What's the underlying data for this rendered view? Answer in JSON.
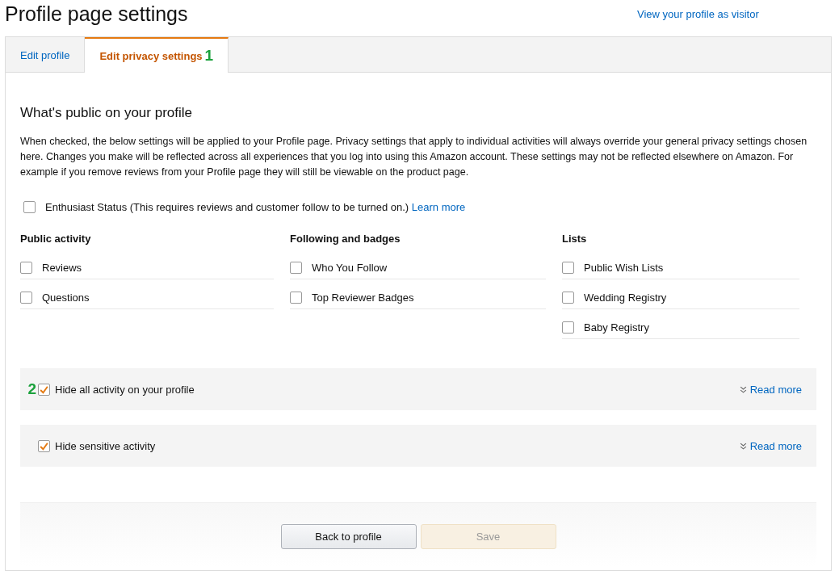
{
  "page": {
    "title": "Profile page settings",
    "visitor_link": "View your profile as visitor"
  },
  "tabs": [
    {
      "label": "Edit profile",
      "selected": false
    },
    {
      "label": "Edit privacy settings",
      "selected": true,
      "callout": "1"
    }
  ],
  "section": {
    "heading": "What's public on your profile",
    "description": "When checked, the below settings will be applied to your Profile page. Privacy settings that apply to individual activities will always override your general privacy settings chosen here. Changes you make will be reflected across all experiences that you log into using this Amazon account. These settings may not be reflected elsewhere on Amazon. For example if you remove reviews from your Profile page they will still be viewable on the product page."
  },
  "enthusiast": {
    "label": "Enthusiast Status (This requires reviews and customer follow to be turned on.)",
    "link": "Learn more",
    "checked": false
  },
  "groups": [
    {
      "heading": "Public activity",
      "items": [
        {
          "label": "Reviews",
          "checked": false
        },
        {
          "label": "Questions",
          "checked": false
        }
      ]
    },
    {
      "heading": "Following and badges",
      "items": [
        {
          "label": "Who You Follow",
          "checked": false
        },
        {
          "label": "Top Reviewer Badges",
          "checked": false
        }
      ]
    },
    {
      "heading": "Lists",
      "items": [
        {
          "label": "Public Wish Lists",
          "checked": false
        },
        {
          "label": "Wedding Registry",
          "checked": false
        },
        {
          "label": "Baby Registry",
          "checked": false
        }
      ]
    }
  ],
  "hide_options": [
    {
      "label": "Hide all activity on your profile",
      "checked": true,
      "callout": "2",
      "link": "Read more"
    },
    {
      "label": "Hide sensitive activity",
      "checked": true,
      "link": "Read more"
    }
  ],
  "buttons": [
    {
      "label": "Back to profile",
      "disabled": false
    },
    {
      "label": "Save",
      "disabled": true
    }
  ]
}
